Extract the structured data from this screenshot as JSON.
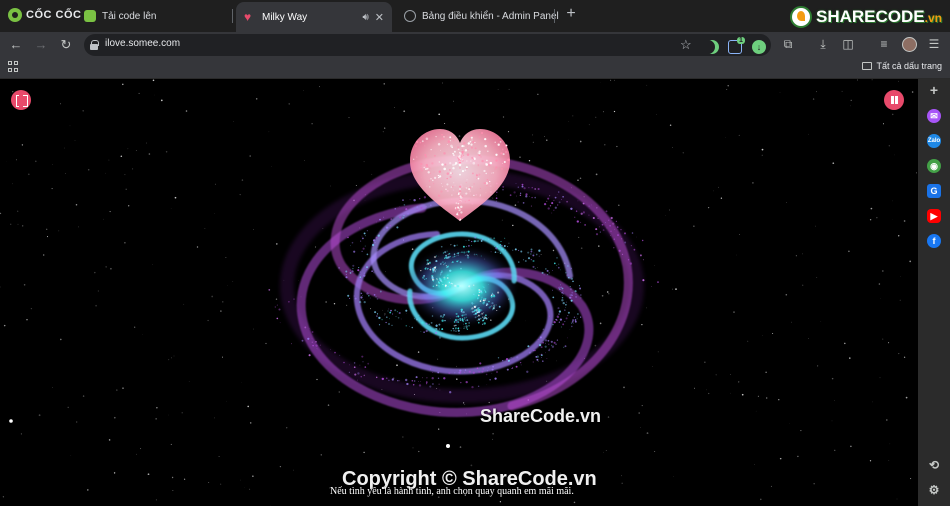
{
  "browser": {
    "brand": "CỐC CỐC",
    "tabs": [
      {
        "title": "Tải code lên",
        "active": false
      },
      {
        "title": "Milky Way",
        "active": true
      },
      {
        "title": "Bảng điều khiển - Admin Panel",
        "active": false
      }
    ],
    "new_tab_label": "+",
    "url": "ilove.somee.com",
    "extension_badge": "1",
    "bookmarks_all_label": "Tất cả dấu trang"
  },
  "overlay_logo": {
    "name": "SHARECODE",
    "domain": ".vn"
  },
  "content": {
    "watermark_center": "ShareCode.vn",
    "watermark_bottom": "Copyright © ShareCode.vn",
    "caption": "Nếu tình yêu là hành tinh, anh chọn quay quanh em mãi mãi."
  },
  "colors": {
    "accent": "#e84a6b",
    "heart": "#ffb3c6",
    "galaxy_core": "#3ff0f0",
    "galaxy_arm": "#b04ad8"
  }
}
